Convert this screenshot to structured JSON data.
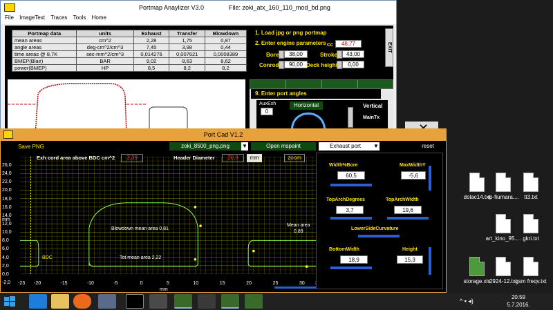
{
  "portmap": {
    "title": "Portmap Anaylizer V3.0",
    "file": "File: zoki_atx_160_110_mod_bd.png",
    "menu": [
      "File",
      "ImageText",
      "Traces",
      "Tools",
      "Home"
    ],
    "table": {
      "headers": [
        "Portmap data",
        "units",
        "Exhaust",
        "Transfer",
        "Blowdown"
      ],
      "rows": [
        [
          "mean areas",
          "cm^2",
          "2,28",
          "1,75",
          "0,87"
        ],
        [
          "angle areas",
          "deg-cm^2/cm^3",
          "7,45",
          "3,98",
          "0,44"
        ],
        [
          "time areas @ 8,7K",
          "sec-mm^2/cm^3",
          "0,014276",
          "0,007621",
          "0,0008389"
        ],
        [
          "BMEP(Blair)",
          "BAR",
          "9,02",
          "8,63",
          "8,62"
        ],
        [
          "power(BMEP)",
          "HP",
          "8,5",
          "8,2",
          "8,2"
        ]
      ]
    },
    "load_label": "1. Load jpg or png portmap",
    "engine_label": "2. Enter engine parameters",
    "cc_label": "cc",
    "cc_value": "48,77",
    "bore_label": "Bore",
    "bore_value": "38,00",
    "stroke_label": "Stroke",
    "stroke_value": "43,00",
    "conrod_label": "Conrod",
    "conrod_value": "90,00",
    "deck_label": "Deck height",
    "deck_value": "0,00",
    "exit_label": "EXIT",
    "angles_label": "9. Enter port angles",
    "auxexh_label": "AuxExh",
    "auxexh_value": "0",
    "horizontal_label": "Horizontal",
    "vertical_label": "Vertical",
    "maintx_label": "MainTx"
  },
  "portcad": {
    "title": "Port Cad  V1.2",
    "save_png": "Save PNG",
    "file_select": "zoki_8500_png.png",
    "open_mspaint": "Open mspaint",
    "port_select": "Exhaust port",
    "reset": "reset",
    "exh_area_label": "Exh cord area above BDC  cm^2",
    "exh_area_value": "3,39",
    "header_label": "Header Diameter",
    "header_value": "20,8",
    "mm_label": "mm",
    "zoom": "zoom",
    "y_axis_label": "mm",
    "x_axis_label": "mm",
    "y_ticks": [
      "26,0",
      "24,0",
      "22,0",
      "20,0",
      "18,0",
      "16,0",
      "14,0",
      "12,0",
      "10,0",
      "8,0",
      "6,0",
      "4,0",
      "2,0",
      "0,0",
      "-2,0"
    ],
    "x_ticks": [
      "-23",
      "-20",
      "-15",
      "-10",
      "-5",
      "0",
      "5",
      "10",
      "15",
      "20",
      "25",
      "30",
      "33"
    ],
    "blowdown_text": "Blowdown mean area 0,81",
    "tot_text": "Tot mean area 2,22",
    "mean_area_text": "Mean area",
    "mean_area_value": "0,89",
    "bdc_text": "BDC",
    "controls": {
      "width_bore_label": "Width%Bore",
      "width_bore_value": "60,5",
      "max_width_y_label": "MaxWidthY",
      "max_width_y_value": "-5,6",
      "top_arch_deg_label": "TopArchDegrees",
      "top_arch_deg_value": "3,7",
      "top_arch_width_label": "TopArchWidth",
      "top_arch_width_value": "19,6",
      "lower_side_label": "LowerSideCurvature",
      "bottom_width_label": "BottomWidth",
      "bottom_width_value": "18,9",
      "height_label": "Height",
      "height_value": "15,3"
    }
  },
  "desktop": {
    "icons": [
      {
        "label": "dolac14.txt"
      },
      {
        "label": "rp-fiumara...."
      },
      {
        "label": "tt3.txt"
      },
      {
        "label": "art_kino_95...."
      },
      {
        "label": "gkri.txt"
      },
      {
        "label": "storage.xls"
      },
      {
        "label": "2924-12.txt"
      },
      {
        "label": "gsm freqv.txt"
      }
    ]
  },
  "taskbar": {
    "time": "20:59",
    "date": "5.7.2016."
  },
  "colors": {
    "plot_bg": "#000000",
    "grid": "#e6e600",
    "port_outline": "#90ff40",
    "yellow_label": "#ffe000",
    "red_value": "#ff3030"
  }
}
